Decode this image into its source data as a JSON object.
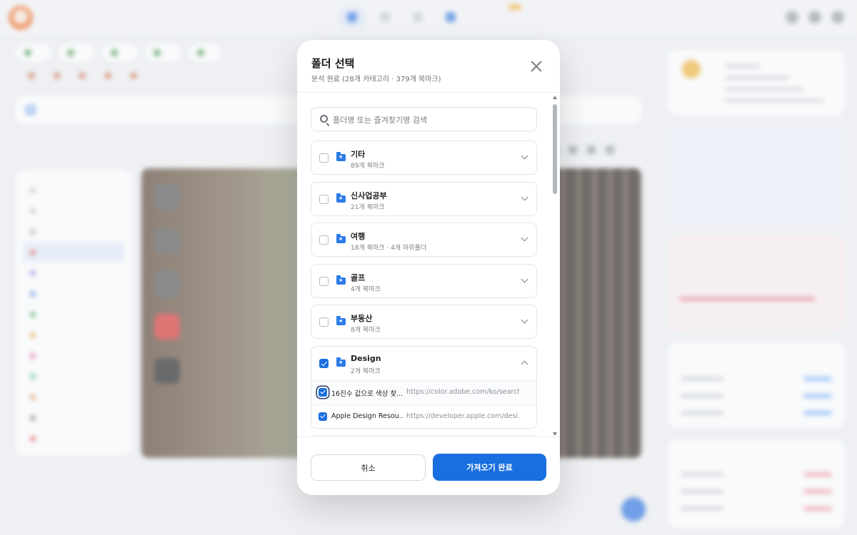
{
  "modal": {
    "title": "폴더 선택",
    "subtitle": "분석 완료 (28개 카테고리 · 379개 북마크)",
    "search_placeholder": "폴더명 또는 즐겨찾기명 검색",
    "folders": [
      {
        "name": "기타",
        "meta": "89개 북마크",
        "checked": false,
        "expanded": false
      },
      {
        "name": "신사업공부",
        "meta": "21개 북마크",
        "checked": false,
        "expanded": false
      },
      {
        "name": "여행",
        "meta": "18개 북마크 · 4개 하위폴더",
        "checked": false,
        "expanded": false
      },
      {
        "name": "골프",
        "meta": "4개 북마크",
        "checked": false,
        "expanded": false
      },
      {
        "name": "부동산",
        "meta": "8개 북마크",
        "checked": false,
        "expanded": false
      },
      {
        "name": "Design",
        "meta": "2개 북마크",
        "checked": true,
        "expanded": true
      }
    ],
    "bookmarks": [
      {
        "title": "16진수 값으로 색상 찾...",
        "url": "https://color.adobe.com/ko/search",
        "checked": true
      },
      {
        "title": "Apple Design Resou...",
        "url": "https://developer.apple.com/desi...",
        "checked": true
      }
    ],
    "cancel_label": "취소",
    "confirm_label": "가져오기 완료"
  },
  "colors": {
    "accent": "#1a6fe0",
    "folder_icon": "#2c7bea"
  }
}
